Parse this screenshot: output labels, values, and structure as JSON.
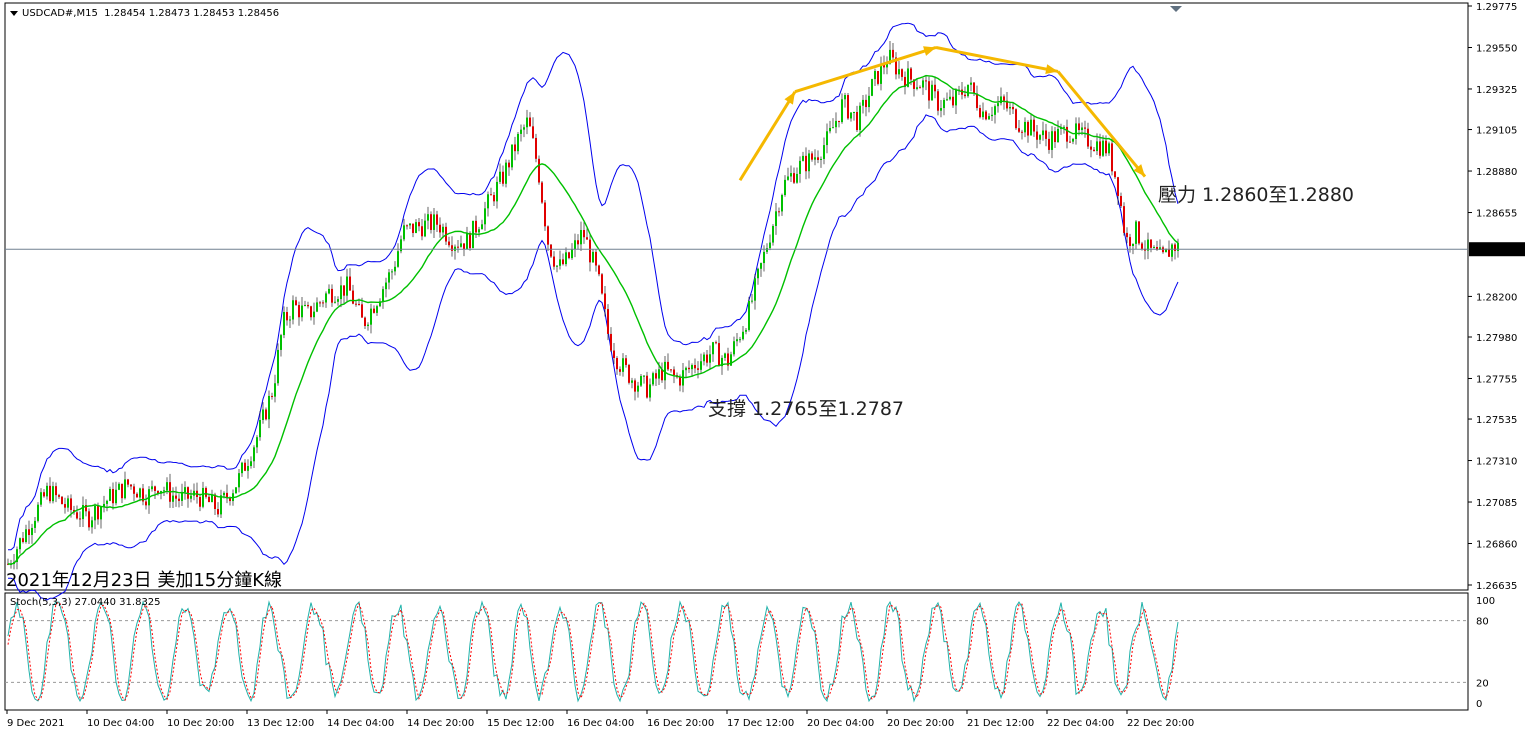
{
  "header": {
    "symbol": "USDCAD#,M15",
    "ohlc": "1.28454 1.28473 1.28453 1.28456"
  },
  "annotations": {
    "caption": "2021年12月23日 美加15分鐘K線",
    "resistance": "壓力 1.2860至1.2880",
    "support": "支撐 1.2765至1.2787"
  },
  "indicator": {
    "label": "Stoch(5,3,3) 27.0440 31.8325"
  },
  "colors": {
    "bollinger": "#0000ee",
    "up_candle": "#00c000",
    "down_candle": "#e00000",
    "ma": "#00c000",
    "price_line": "#708090",
    "trend_arrow": "#f5b800",
    "stoch_main": "#20b2aa",
    "stoch_signal": "#ff0000"
  },
  "chart_data": [
    {
      "type": "candlestick",
      "title": "USDCAD#,M15",
      "ylim": [
        1.26635,
        1.29775
      ],
      "y_ticks": [
        "1.29775",
        "1.29550",
        "1.29325",
        "1.29105",
        "1.28880",
        "1.28655",
        "1.28200",
        "1.27980",
        "1.27755",
        "1.27535",
        "1.27310",
        "1.27085",
        "1.26860",
        "1.26635"
      ],
      "current_price": "1.28456",
      "x_ticks": [
        "9 Dec 2021",
        "10 Dec 04:00",
        "10 Dec 20:00",
        "13 Dec 12:00",
        "14 Dec 04:00",
        "14 Dec 20:00",
        "15 Dec 12:00",
        "16 Dec 04:00",
        "16 Dec 20:00",
        "17 Dec 12:00",
        "20 Dec 04:00",
        "20 Dec 20:00",
        "21 Dec 12:00",
        "22 Dec 04:00",
        "22 Dec 20:00"
      ],
      "price_path": [
        [
          0,
          1.2675
        ],
        [
          20,
          1.2695
        ],
        [
          40,
          1.2715
        ],
        [
          60,
          1.2705
        ],
        [
          80,
          1.27
        ],
        [
          100,
          1.271
        ],
        [
          120,
          1.2718
        ],
        [
          140,
          1.2712
        ],
        [
          150,
          1.2718
        ],
        [
          170,
          1.271
        ],
        [
          190,
          1.2712
        ],
        [
          210,
          1.2705
        ],
        [
          230,
          1.272
        ],
        [
          250,
          1.2745
        ],
        [
          265,
          1.277
        ],
        [
          275,
          1.2805
        ],
        [
          285,
          1.2815
        ],
        [
          300,
          1.281
        ],
        [
          320,
          1.2822
        ],
        [
          340,
          1.2825
        ],
        [
          355,
          1.2805
        ],
        [
          370,
          1.282
        ],
        [
          385,
          1.2835
        ],
        [
          395,
          1.2855
        ],
        [
          410,
          1.2858
        ],
        [
          430,
          1.286
        ],
        [
          445,
          1.285
        ],
        [
          460,
          1.285
        ],
        [
          480,
          1.287
        ],
        [
          495,
          1.2885
        ],
        [
          510,
          1.2905
        ],
        [
          520,
          1.2915
        ],
        [
          530,
          1.289
        ],
        [
          540,
          1.285
        ],
        [
          550,
          1.2835
        ],
        [
          560,
          1.284
        ],
        [
          575,
          1.2855
        ],
        [
          590,
          1.283
        ],
        [
          600,
          1.28
        ],
        [
          610,
          1.2785
        ],
        [
          625,
          1.2775
        ],
        [
          640,
          1.277
        ],
        [
          655,
          1.278
        ],
        [
          670,
          1.2775
        ],
        [
          690,
          1.2785
        ],
        [
          705,
          1.279
        ],
        [
          720,
          1.2785
        ],
        [
          740,
          1.281
        ],
        [
          760,
          1.285
        ],
        [
          775,
          1.288
        ],
        [
          790,
          1.289
        ],
        [
          805,
          1.2895
        ],
        [
          820,
          1.2905
        ],
        [
          835,
          1.2925
        ],
        [
          850,
          1.2915
        ],
        [
          865,
          1.2935
        ],
        [
          880,
          1.295
        ],
        [
          895,
          1.294
        ],
        [
          915,
          1.2935
        ],
        [
          930,
          1.2925
        ],
        [
          945,
          1.2925
        ],
        [
          960,
          1.2935
        ],
        [
          975,
          1.292
        ],
        [
          995,
          1.2925
        ],
        [
          1010,
          1.2915
        ],
        [
          1025,
          1.291
        ],
        [
          1040,
          1.2905
        ],
        [
          1060,
          1.291
        ],
        [
          1080,
          1.2905
        ],
        [
          1100,
          1.29
        ],
        [
          1110,
          1.288
        ],
        [
          1118,
          1.285
        ],
        [
          1128,
          1.2855
        ],
        [
          1140,
          1.2845
        ],
        [
          1155,
          1.284
        ],
        [
          1165,
          1.2848
        ],
        [
          1172,
          1.2846
        ]
      ],
      "resistance_label": "壓力 1.2860至1.2880",
      "support_label": "支撐 1.2765至1.2787",
      "trend_arrows": [
        {
          "from": [
            740,
            1.2883
          ],
          "to": [
            795,
            1.2931
          ]
        },
        {
          "from": [
            795,
            1.2931
          ],
          "to": [
            936,
            1.2955
          ]
        },
        {
          "from": [
            936,
            1.2955
          ],
          "to": [
            1058,
            1.2942
          ]
        },
        {
          "from": [
            1058,
            1.2942
          ],
          "to": [
            1145,
            1.2885
          ]
        }
      ]
    },
    {
      "type": "line",
      "title": "Stoch(5,3,3) 27.0440 31.8325",
      "ylim": [
        0,
        100
      ],
      "y_ticks": [
        "100",
        "80",
        "20",
        "0"
      ],
      "levels": [
        80,
        20
      ],
      "series": [
        {
          "name": "27.0440"
        },
        {
          "name": "31.8325"
        }
      ]
    }
  ]
}
